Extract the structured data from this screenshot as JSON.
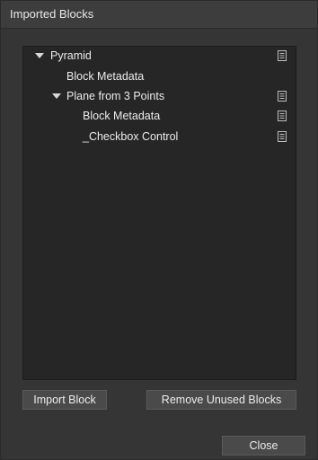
{
  "window": {
    "title": "Imported Blocks"
  },
  "tree": {
    "items": [
      {
        "label": "Pyramid",
        "level": 0,
        "expanded": true,
        "has_toggle": true,
        "has_icon": true
      },
      {
        "label": "Block Metadata",
        "level": 1,
        "has_toggle": false,
        "has_icon": false
      },
      {
        "label": "Plane from 3 Points",
        "level": 1,
        "expanded": true,
        "has_toggle": true,
        "has_icon": true
      },
      {
        "label": "Block Metadata",
        "level": 2,
        "has_toggle": false,
        "has_icon": true
      },
      {
        "label": "_Checkbox Control",
        "level": 2,
        "has_toggle": false,
        "has_icon": true
      }
    ],
    "icon_name": "document-icon"
  },
  "buttons": {
    "import_label": "Import Block",
    "remove_unused_label": "Remove Unused Blocks",
    "close_label": "Close"
  }
}
